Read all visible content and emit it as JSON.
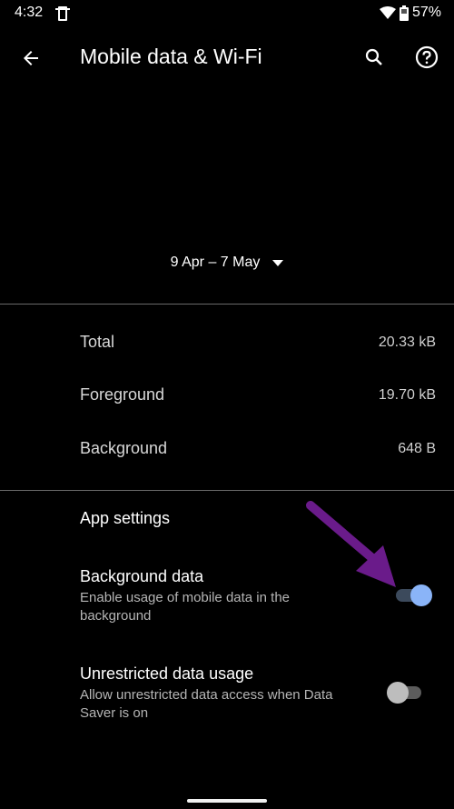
{
  "status_bar": {
    "time": "4:32",
    "battery": "57%",
    "icons": [
      "screen-cast-icon",
      "wifi-icon",
      "battery-icon"
    ]
  },
  "app_bar": {
    "title": "Mobile data & Wi-Fi",
    "back_icon": "arrow-back-icon",
    "search_icon": "search-icon",
    "help_icon": "help-icon"
  },
  "date_range": {
    "label": "9 Apr – 7 May",
    "icon": "dropdown-arrow-icon"
  },
  "usage": [
    {
      "label": "Total",
      "value": "20.33 kB"
    },
    {
      "label": "Foreground",
      "value": "19.70 kB"
    },
    {
      "label": "Background",
      "value": "648 B"
    }
  ],
  "app_settings": {
    "title": "App settings",
    "prefs": [
      {
        "title": "Background data",
        "summary": "Enable usage of mobile data in the background",
        "enabled": true
      },
      {
        "title": "Unrestricted data usage",
        "summary": "Allow unrestricted data access when Data Saver is on",
        "enabled": false
      }
    ]
  },
  "colors": {
    "accent": "#8ab4f8",
    "annotation_arrow": "#6a1b8a"
  }
}
